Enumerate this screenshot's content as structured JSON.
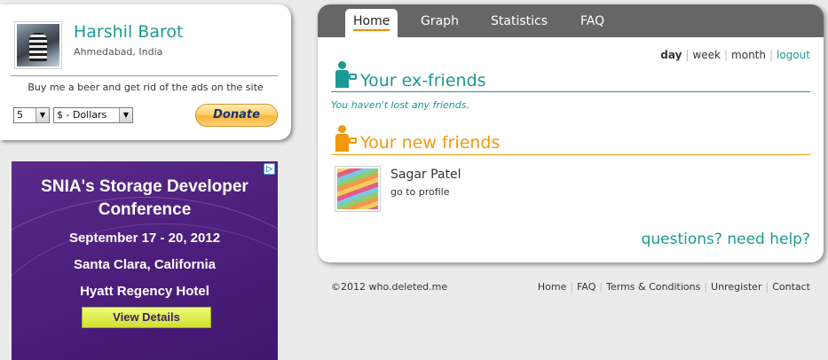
{
  "profile": {
    "name": "Harshil Barot",
    "location": "Ahmedabad, India",
    "beer_text": "Buy me a beer and get rid of the ads on the site",
    "quantity": "5",
    "currency": "$ - Dollars",
    "donate_label": "Donate"
  },
  "ad": {
    "icon": "adchoices-icon",
    "title_line1": "SNIA's Storage Developer",
    "title_line2": "Conference",
    "dates": "September 17 - 20, 2012",
    "location": "Santa Clara, California",
    "venue": "Hyatt Regency Hotel",
    "button_label": "View Details"
  },
  "tabs": [
    {
      "label": "Home",
      "active": true
    },
    {
      "label": "Graph"
    },
    {
      "label": "Statistics"
    },
    {
      "label": "FAQ"
    }
  ],
  "period_links": [
    "day",
    "week",
    "month",
    "logout"
  ],
  "ex_friends": {
    "title": "Your ex-friends",
    "status": "You haven't lost any friends."
  },
  "new_friends": {
    "title": "Your new friends",
    "items": [
      {
        "name": "Sagar Patel",
        "link": "go to profile"
      }
    ]
  },
  "help_link": "questions? need help?",
  "footer": {
    "copyright": "©2012 who.deleted.me",
    "links": [
      "Home",
      "FAQ",
      "Terms & Conditions",
      "Unregister",
      "Contact"
    ]
  },
  "colors": {
    "teal": "#1b9a93",
    "orange": "#f19a0e",
    "tab_bar": "#666666",
    "ad_bg": "#4c1f7c"
  }
}
